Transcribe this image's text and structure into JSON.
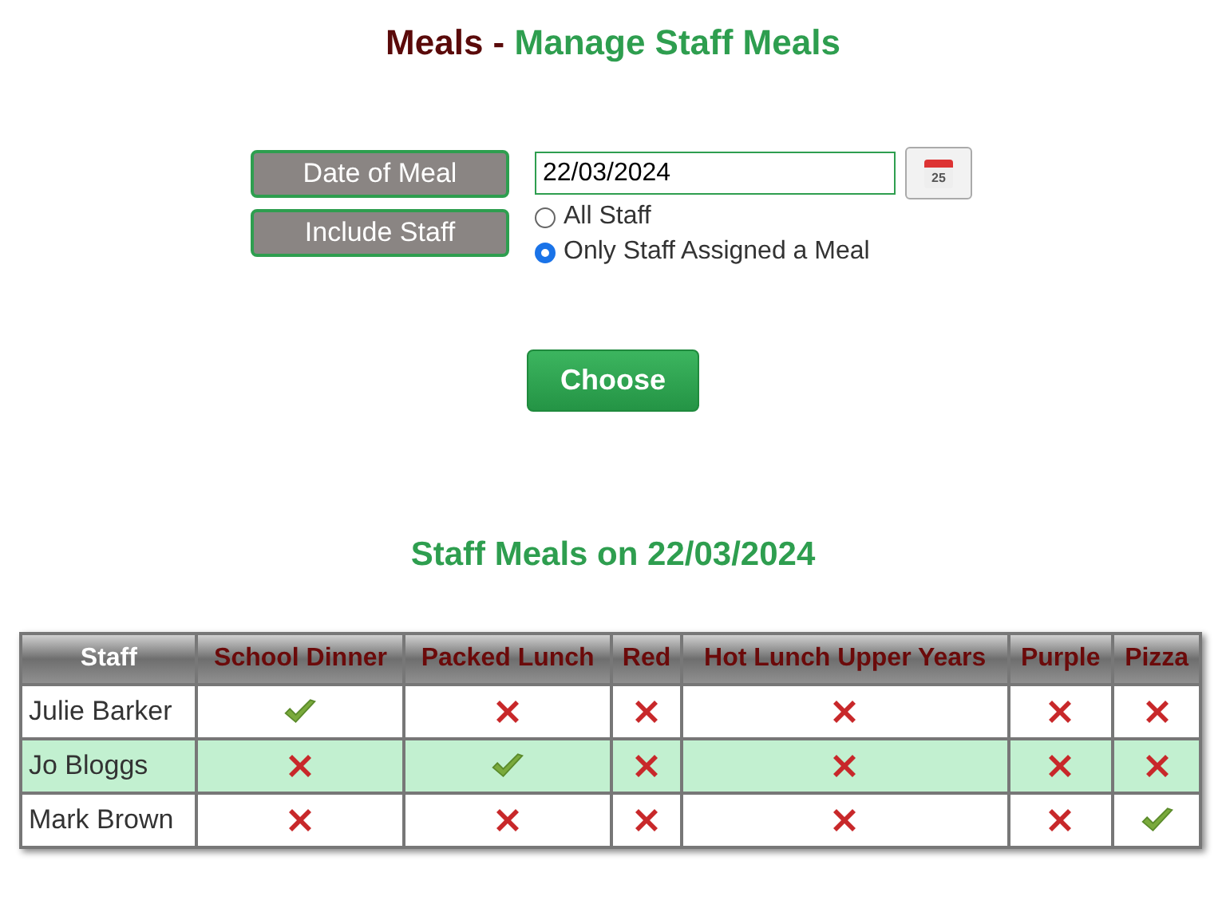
{
  "title": {
    "prefix": "Meals -",
    "main": "Manage Staff Meals"
  },
  "form": {
    "date_label": "Date of Meal",
    "date_value": "22/03/2024",
    "calendar_day": "25",
    "include_label": "Include Staff",
    "options": [
      {
        "label": "All Staff",
        "selected": false
      },
      {
        "label": "Only Staff Assigned a Meal",
        "selected": true
      }
    ]
  },
  "choose_button": "Choose",
  "results_title": "Staff Meals on 22/03/2024",
  "table": {
    "columns": [
      "Staff",
      "School Dinner",
      "Packed Lunch",
      "Red",
      "Hot Lunch Upper Years",
      "Purple",
      "Pizza"
    ],
    "rows": [
      {
        "name": "Julie Barker",
        "highlighted": false,
        "meals": [
          true,
          false,
          false,
          false,
          false,
          false
        ]
      },
      {
        "name": "Jo Bloggs",
        "highlighted": true,
        "meals": [
          false,
          true,
          false,
          false,
          false,
          false
        ]
      },
      {
        "name": "Mark Brown",
        "highlighted": false,
        "meals": [
          false,
          false,
          false,
          false,
          false,
          true
        ]
      }
    ]
  }
}
